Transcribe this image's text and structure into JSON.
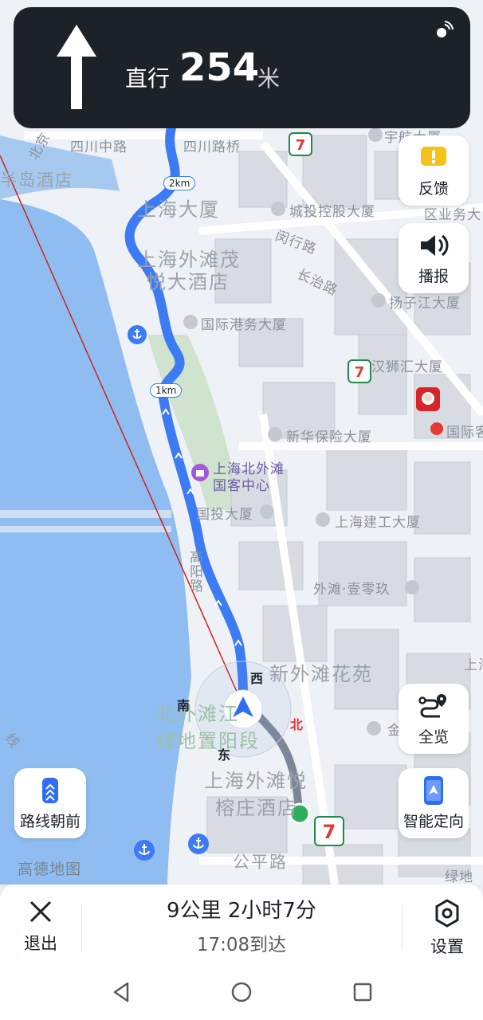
{
  "banner": {
    "instruction": "直行",
    "distance": "254",
    "unit": "米",
    "arrow_icon": "straight-arrow",
    "gps_icon": "satellite-signal"
  },
  "map": {
    "labels": {
      "sichuan_middle_rd": "四川中路",
      "sichuan_rd_bridge": "四川路桥",
      "bund_ne": "北京",
      "peninsula_hotel": "半岛酒店",
      "shanghai_mansion": "上海大厦",
      "chengtou_bldg": "城投控股大厦",
      "yuhang_bldg": "宇航大厦",
      "district_gov": "区业务大",
      "minxing_rd": "闵行路",
      "changzhi_rd": "长治路",
      "bund_mao": "上海外滩茂",
      "yue_hotel": "悦大酒店",
      "yangtze_bldg": "扬子江大厦",
      "intl_port_bldg": "国际港务大厦",
      "hanshi_bldg": "汉狮汇大厦",
      "xinhua_ins_bldg": "新华保险大厦",
      "intl_right": "国际客",
      "north_bund": "上海北外滩",
      "guest_center": "国客中心",
      "guotou_bldg": "国投大厦",
      "shanghai_jiangong": "上海建工大厦",
      "bund_one_zero_nine": "外滩·壹零玖",
      "gaoyang_rd": "高阳路",
      "new_bund_garden": "新外滩花苑",
      "north_bund_park": "北外滩江",
      "green_sunshine": "绿地置阳段",
      "banyan_tree": "上海外滩悦",
      "banyan_hotel": "榕庄酒店",
      "gongping_rd": "公平路",
      "amap_logo": "高德地图",
      "shanghai_right": "上海",
      "jin_right": "金",
      "lvdi_right": "绿地",
      "line_left": "线",
      "scale_2km": "2km",
      "scale_1km": "1km"
    },
    "compass": {
      "west": "西",
      "south": "南",
      "east": "东",
      "north": "北"
    }
  },
  "controls": {
    "feedback": "反馈",
    "broadcast": "播报",
    "route_forward": "路线朝前",
    "overview": "全览",
    "smart_orientation": "智能定向"
  },
  "bottom_bar": {
    "exit": "退出",
    "summary": "9公里  2小时7分",
    "eta": "17:08到达",
    "settings": "设置"
  },
  "colors": {
    "banner_bg": "#1d2229",
    "route_blue": "#3d7bf5",
    "river": "#8fbdf2",
    "north_red": "#e53935",
    "feedback_yellow": "#f5c218",
    "overview_blue": "#2f6df6"
  }
}
